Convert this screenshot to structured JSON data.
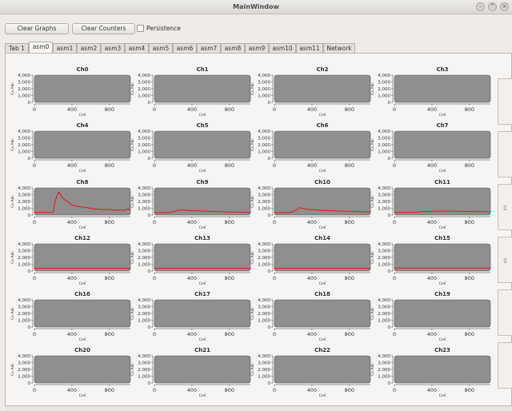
{
  "window": {
    "title": "MainWindow"
  },
  "toolbar": {
    "clear_graphs": "Clear Graphs",
    "clear_counters": "Clear Counters",
    "persistence": "Persistence",
    "persistence_checked": false
  },
  "tabs": [
    {
      "label": "Tab 1"
    },
    {
      "label": "asm0",
      "active": true
    },
    {
      "label": "asm1"
    },
    {
      "label": "asm2"
    },
    {
      "label": "asm3"
    },
    {
      "label": "asm4"
    },
    {
      "label": "asm5"
    },
    {
      "label": "asm6"
    },
    {
      "label": "asm7"
    },
    {
      "label": "asm8"
    },
    {
      "label": "asm9"
    },
    {
      "label": "asm10"
    },
    {
      "label": "asm11"
    },
    {
      "label": "Network"
    }
  ],
  "colors": {
    "plot_background": "#8f8f8f",
    "series": "#ff0000",
    "window_background": "#efebe7"
  },
  "chart_data": [
    {
      "title": "Ch0",
      "type": "line",
      "xlabel": "Cell",
      "ylabel": "Cx Adc",
      "xlim": [
        0,
        1023
      ],
      "ylim": [
        0,
        4000
      ],
      "yticks": [
        "4,000",
        "3,000",
        "2,000",
        "1,000",
        "0"
      ],
      "xticks": [
        "0",
        "400",
        "800"
      ],
      "series": []
    },
    {
      "title": "Ch1",
      "type": "line",
      "xlabel": "Cell",
      "ylabel": "Cx Adc",
      "xlim": [
        0,
        1023
      ],
      "ylim": [
        0,
        4000
      ],
      "yticks": [
        "4,000",
        "3,000",
        "2,000",
        "1,000",
        "0"
      ],
      "xticks": [
        "0",
        "400",
        "800"
      ],
      "series": []
    },
    {
      "title": "Ch2",
      "type": "line",
      "xlabel": "Cell",
      "ylabel": "Cx Adc",
      "xlim": [
        0,
        1023
      ],
      "ylim": [
        0,
        4000
      ],
      "yticks": [
        "4,000",
        "3,000",
        "2,000",
        "1,000",
        "0"
      ],
      "xticks": [
        "0",
        "400",
        "800"
      ],
      "series": []
    },
    {
      "title": "Ch3",
      "type": "line",
      "xlabel": "Cell",
      "ylabel": "Cx Adc",
      "xlim": [
        0,
        1023
      ],
      "ylim": [
        0,
        4000
      ],
      "yticks": [
        "4,000",
        "3,000",
        "2,000",
        "1,000",
        "0"
      ],
      "xticks": [
        "0",
        "400",
        "800"
      ],
      "series": []
    },
    {
      "title": "Ch4",
      "type": "line",
      "xlabel": "Cell",
      "ylabel": "Cx Adc",
      "xlim": [
        0,
        1023
      ],
      "ylim": [
        0,
        4000
      ],
      "yticks": [
        "4,000",
        "3,000",
        "2,000",
        "1,000",
        "0"
      ],
      "xticks": [
        "0",
        "400",
        "800"
      ],
      "series": []
    },
    {
      "title": "Ch5",
      "type": "line",
      "xlabel": "Cell",
      "ylabel": "Cx Adc",
      "xlim": [
        0,
        1023
      ],
      "ylim": [
        0,
        4000
      ],
      "yticks": [
        "4,000",
        "3,000",
        "2,000",
        "1,000",
        "0"
      ],
      "xticks": [
        "0",
        "400",
        "800"
      ],
      "series": []
    },
    {
      "title": "Ch6",
      "type": "line",
      "xlabel": "Cell",
      "ylabel": "Cx Adc",
      "xlim": [
        0,
        1023
      ],
      "ylim": [
        0,
        4000
      ],
      "yticks": [
        "4,000",
        "3,000",
        "2,000",
        "1,000",
        "0"
      ],
      "xticks": [
        "0",
        "400",
        "800"
      ],
      "series": []
    },
    {
      "title": "Ch7",
      "type": "line",
      "xlabel": "Cell",
      "ylabel": "Cx Adc",
      "xlim": [
        0,
        1023
      ],
      "ylim": [
        0,
        4000
      ],
      "yticks": [
        "4,000",
        "3,000",
        "2,000",
        "1,000",
        "0"
      ],
      "xticks": [
        "0",
        "400",
        "800"
      ],
      "series": []
    },
    {
      "title": "Ch8",
      "type": "line",
      "xlabel": "Cell",
      "ylabel": "Cx Adc",
      "xlim": [
        0,
        1023
      ],
      "ylim": [
        0,
        4000
      ],
      "yticks": [
        "4,000",
        "3,000",
        "2,000",
        "1,000",
        "0"
      ],
      "xticks": [
        "0",
        "400",
        "800"
      ],
      "series": [
        {
          "x": [
            0,
            150,
            200,
            220,
            240,
            260,
            280,
            300,
            350,
            400,
            450,
            500,
            550,
            600,
            650,
            700,
            750,
            800,
            850,
            900,
            950,
            1000,
            1023
          ],
          "y": [
            380,
            400,
            420,
            2000,
            2800,
            3400,
            3000,
            2500,
            2000,
            1500,
            1300,
            1200,
            1100,
            1000,
            900,
            850,
            800,
            850,
            700,
            750,
            700,
            900,
            750
          ]
        }
      ]
    },
    {
      "title": "Ch9",
      "type": "line",
      "xlabel": "Cell",
      "ylabel": "Cx Adc",
      "xlim": [
        0,
        1023
      ],
      "ylim": [
        0,
        4000
      ],
      "yticks": [
        "4,000",
        "3,000",
        "2,000",
        "1,000",
        "0"
      ],
      "xticks": [
        "0",
        "400",
        "800"
      ],
      "series": [
        {
          "x": [
            0,
            150,
            200,
            250,
            300,
            350,
            400,
            500,
            600,
            700,
            800,
            900,
            1023
          ],
          "y": [
            350,
            360,
            500,
            700,
            750,
            700,
            650,
            600,
            550,
            500,
            450,
            450,
            420
          ]
        }
      ]
    },
    {
      "title": "Ch10",
      "type": "line",
      "xlabel": "Cell",
      "ylabel": "Cx Adc",
      "xlim": [
        0,
        1023
      ],
      "ylim": [
        0,
        4000
      ],
      "yticks": [
        "4,000",
        "3,000",
        "2,000",
        "1,000",
        "0"
      ],
      "xticks": [
        "0",
        "400",
        "800"
      ],
      "series": [
        {
          "x": [
            0,
            150,
            200,
            250,
            270,
            300,
            350,
            400,
            500,
            600,
            700,
            800,
            900,
            1023
          ],
          "y": [
            350,
            360,
            500,
            900,
            1100,
            1000,
            850,
            800,
            700,
            650,
            600,
            550,
            500,
            450
          ]
        }
      ]
    },
    {
      "title": "Ch11",
      "type": "line",
      "xlabel": "Cell",
      "ylabel": "Cx Adc",
      "xlim": [
        0,
        1023
      ],
      "ylim": [
        0,
        4000
      ],
      "yticks": [
        "4,000",
        "3,000",
        "2,000",
        "1,000",
        "0"
      ],
      "xticks": [
        "0",
        "400",
        "800"
      ],
      "series": [
        {
          "x": [
            0,
            200,
            300,
            400,
            500,
            600,
            700,
            800,
            1023
          ],
          "y": [
            380,
            400,
            500,
            550,
            600,
            580,
            550,
            520,
            500
          ]
        }
      ]
    },
    {
      "title": "Ch12",
      "type": "line",
      "xlabel": "Cell",
      "ylabel": "Cx Adc",
      "xlim": [
        0,
        1023
      ],
      "ylim": [
        0,
        4000
      ],
      "yticks": [
        "4,000",
        "3,000",
        "2,000",
        "1,000",
        "0"
      ],
      "xticks": [
        "0",
        "400",
        "800"
      ],
      "series": [
        {
          "x": [
            0,
            1023
          ],
          "y": [
            420,
            420
          ]
        }
      ]
    },
    {
      "title": "Ch13",
      "type": "line",
      "xlabel": "Cell",
      "ylabel": "Cx Adc",
      "xlim": [
        0,
        1023
      ],
      "ylim": [
        0,
        4000
      ],
      "yticks": [
        "4,000",
        "3,000",
        "2,000",
        "1,000",
        "0"
      ],
      "xticks": [
        "0",
        "400",
        "800"
      ],
      "series": [
        {
          "x": [
            0,
            1023
          ],
          "y": [
            400,
            400
          ]
        }
      ]
    },
    {
      "title": "Ch14",
      "type": "line",
      "xlabel": "Cell",
      "ylabel": "Cx Adc",
      "xlim": [
        0,
        1023
      ],
      "ylim": [
        0,
        4000
      ],
      "yticks": [
        "4,000",
        "3,000",
        "2,000",
        "1,000",
        "0"
      ],
      "xticks": [
        "0",
        "400",
        "800"
      ],
      "series": [
        {
          "x": [
            0,
            1023
          ],
          "y": [
            400,
            400
          ]
        }
      ]
    },
    {
      "title": "Ch15",
      "type": "line",
      "xlabel": "Cell",
      "ylabel": "Cx Adc",
      "xlim": [
        0,
        1023
      ],
      "ylim": [
        0,
        4000
      ],
      "yticks": [
        "4,000",
        "3,000",
        "2,000",
        "1,000",
        "0"
      ],
      "xticks": [
        "0",
        "400",
        "800"
      ],
      "series": [
        {
          "x": [
            0,
            1023
          ],
          "y": [
            450,
            450
          ]
        }
      ]
    },
    {
      "title": "Ch16",
      "type": "line",
      "xlabel": "Cell",
      "ylabel": "Cx Adc",
      "xlim": [
        0,
        1023
      ],
      "ylim": [
        0,
        4000
      ],
      "yticks": [
        "4,000",
        "3,000",
        "2,000",
        "1,000",
        "0"
      ],
      "xticks": [
        "0",
        "400",
        "800"
      ],
      "series": []
    },
    {
      "title": "Ch17",
      "type": "line",
      "xlabel": "Cell",
      "ylabel": "Cx Adc",
      "xlim": [
        0,
        1023
      ],
      "ylim": [
        0,
        4000
      ],
      "yticks": [
        "4,000",
        "3,000",
        "2,000",
        "1,000",
        "0"
      ],
      "xticks": [
        "0",
        "400",
        "800"
      ],
      "series": []
    },
    {
      "title": "Ch18",
      "type": "line",
      "xlabel": "Cell",
      "ylabel": "Cx Adc",
      "xlim": [
        0,
        1023
      ],
      "ylim": [
        0,
        4000
      ],
      "yticks": [
        "4,000",
        "3,000",
        "2,000",
        "1,000",
        "0"
      ],
      "xticks": [
        "0",
        "400",
        "800"
      ],
      "series": []
    },
    {
      "title": "Ch19",
      "type": "line",
      "xlabel": "Cell",
      "ylabel": "Cx Adc",
      "xlim": [
        0,
        1023
      ],
      "ylim": [
        0,
        4000
      ],
      "yticks": [
        "4,000",
        "3,000",
        "2,000",
        "1,000",
        "0"
      ],
      "xticks": [
        "0",
        "400",
        "800"
      ],
      "series": []
    },
    {
      "title": "Ch20",
      "type": "line",
      "xlabel": "Cell",
      "ylabel": "Cx Adc",
      "xlim": [
        0,
        1023
      ],
      "ylim": [
        0,
        4000
      ],
      "yticks": [
        "4,000",
        "3,000",
        "2,000",
        "1,000",
        "0"
      ],
      "xticks": [
        "0",
        "400",
        "800"
      ],
      "series": []
    },
    {
      "title": "Ch21",
      "type": "line",
      "xlabel": "Cell",
      "ylabel": "Cx Adc",
      "xlim": [
        0,
        1023
      ],
      "ylim": [
        0,
        4000
      ],
      "yticks": [
        "4,000",
        "3,000",
        "2,000",
        "1,000",
        "0"
      ],
      "xticks": [
        "0",
        "400",
        "800"
      ],
      "series": []
    },
    {
      "title": "Ch22",
      "type": "line",
      "xlabel": "Cell",
      "ylabel": "Cx Adc",
      "xlim": [
        0,
        1023
      ],
      "ylim": [
        0,
        4000
      ],
      "yticks": [
        "4,000",
        "3,000",
        "2,000",
        "1,000",
        "0"
      ],
      "xticks": [
        "0",
        "400",
        "800"
      ],
      "series": []
    },
    {
      "title": "Ch23",
      "type": "line",
      "xlabel": "Cell",
      "ylabel": "Cx Adc",
      "xlim": [
        0,
        1023
      ],
      "ylim": [
        0,
        4000
      ],
      "yticks": [
        "4,000",
        "3,000",
        "2,000",
        "1,000",
        "0"
      ],
      "xticks": [
        "0",
        "400",
        "800"
      ],
      "series": []
    }
  ]
}
